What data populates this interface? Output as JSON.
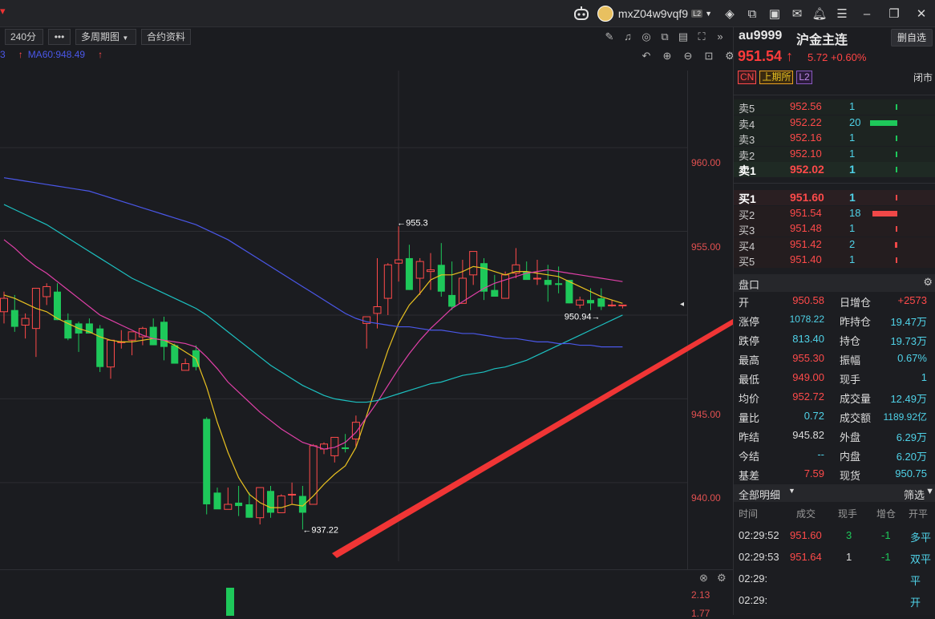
{
  "window": {
    "username": "mxZ04w9vqf9",
    "level_badge": "L2",
    "icons": [
      "robot-icon",
      "layers-icon",
      "export-icon",
      "tv-icon",
      "mail-icon",
      "bell-icon",
      "menu-icon",
      "minimize-icon",
      "restore-icon",
      "close-icon"
    ]
  },
  "toolbar": {
    "period": "240分",
    "more": "•••",
    "multi_period": "多周期图",
    "contract_info": "合约资料"
  },
  "ma_legend": {
    "ma60": "MA60:948.49",
    "ma60_color": "#4a57e8",
    "prefix_fragment": "3"
  },
  "chart": {
    "y_ticks": [
      "960.00",
      "955.00",
      "945.00",
      "940.00"
    ],
    "high_marker": "←955.3",
    "low_marker": "←937.22",
    "last_marker": "950.94→",
    "sub_ticks": [
      "2.13",
      "1.77"
    ]
  },
  "chart_data": {
    "type": "candlestick",
    "ylim": [
      935.3,
      964.6
    ],
    "candles": [
      [
        950.2,
        951.4,
        949.5,
        951.0
      ],
      [
        950.3,
        951.2,
        949.0,
        949.3
      ],
      [
        949.4,
        950.1,
        948.6,
        949.8
      ],
      [
        949.2,
        951.6,
        947.5,
        951.6
      ],
      [
        951.1,
        951.9,
        950.6,
        951.7
      ],
      [
        951.4,
        951.9,
        949.7,
        949.7
      ],
      [
        949.7,
        950.1,
        948.5,
        948.6
      ],
      [
        949.5,
        949.6,
        947.8,
        948.9
      ],
      [
        949.5,
        949.8,
        948.9,
        948.9
      ],
      [
        949.2,
        949.4,
        946.6,
        946.9
      ],
      [
        946.9,
        948.5,
        946.2,
        948.5
      ],
      [
        948.4,
        949.1,
        948.0,
        948.4
      ],
      [
        948.5,
        949.0,
        947.6,
        949.0
      ],
      [
        948.7,
        949.3,
        948.2,
        949.2
      ],
      [
        949.3,
        949.8,
        948.2,
        948.2
      ],
      [
        949.6,
        949.9,
        947.3,
        948.1
      ],
      [
        948.2,
        948.3,
        947.3,
        947.1
      ],
      [
        946.7,
        947.4,
        946.9,
        947.1
      ],
      [
        947.9,
        948.2,
        946.7,
        946.9
      ],
      [
        943.8,
        943.9,
        938.1,
        938.7
      ],
      [
        939.4,
        939.7,
        938.7,
        938.4
      ],
      [
        938.4,
        939.7,
        938.7,
        938.7
      ],
      [
        938.8,
        939.8,
        938.0,
        938.6
      ],
      [
        938.7,
        939.4,
        937.9,
        937.9
      ],
      [
        937.9,
        939.7,
        937.5,
        939.7
      ],
      [
        939.5,
        939.8,
        937.9,
        938.2
      ],
      [
        938.2,
        939.3,
        938.4,
        939.2
      ],
      [
        939.3,
        940.0,
        938.7,
        939.3
      ],
      [
        939.2,
        939.8,
        937.2,
        938.2
      ],
      [
        938.7,
        942.3,
        939.3,
        942.2
      ],
      [
        942.0,
        942.4,
        941.7,
        942.3
      ],
      [
        941.6,
        942.7,
        941.2,
        942.7
      ],
      [
        942.1,
        942.9,
        941.8,
        942.0
      ],
      [
        942.6,
        944.0,
        942.1,
        943.6
      ],
      [
        949.5,
        949.5,
        948.0,
        949.9
      ],
      [
        950.1,
        953.4,
        949.2,
        950.5
      ],
      [
        951.0,
        953.1,
        950.0,
        953.0
      ],
      [
        953.1,
        955.3,
        952.0,
        953.3
      ],
      [
        953.4,
        954.2,
        951.5,
        951.5
      ],
      [
        952.2,
        953.4,
        951.2,
        953.2
      ],
      [
        952.6,
        953.7,
        951.5,
        952.7
      ],
      [
        953.0,
        954.3,
        951.1,
        951.4
      ],
      [
        951.2,
        953.2,
        950.3,
        950.5
      ],
      [
        950.7,
        953.3,
        950.8,
        952.2
      ],
      [
        952.4,
        953.5,
        951.8,
        953.8
      ],
      [
        953.1,
        953.4,
        950.9,
        951.4
      ],
      [
        951.5,
        952.4,
        951.2,
        951.1
      ],
      [
        951.0,
        952.6,
        951.6,
        952.4
      ],
      [
        952.5,
        954.0,
        952.2,
        953.0
      ],
      [
        952.6,
        953.2,
        952.3,
        952.1
      ],
      [
        952.2,
        953.3,
        951.8,
        952.2
      ],
      [
        952.1,
        953.0,
        950.8,
        951.8
      ],
      [
        951.9,
        952.9,
        951.3,
        951.8
      ],
      [
        952.1,
        951.6,
        950.7,
        950.7
      ],
      [
        950.6,
        951.1,
        950.4,
        950.9
      ],
      [
        950.9,
        951.6,
        950.3,
        950.7
      ],
      [
        951.0,
        951.6,
        950.3,
        950.5
      ],
      [
        950.6,
        950.9,
        950.5,
        950.6
      ],
      [
        950.6,
        950.6,
        950.4,
        950.6
      ]
    ],
    "series": [
      {
        "color": "#e8c020",
        "values": [
          951.2,
          951.0,
          950.7,
          950.4,
          950.2,
          949.8,
          949.5,
          949.2,
          949.0,
          948.7,
          948.5,
          948.4,
          948.4,
          948.5,
          948.6,
          948.5,
          948.2,
          947.8,
          947.4,
          945.7,
          943.6,
          941.8,
          940.3,
          939.3,
          938.8,
          938.5,
          938.5,
          938.7,
          938.6,
          939.2,
          939.9,
          940.5,
          941.0,
          942.1,
          944.0,
          946.0,
          947.9,
          949.5,
          950.6,
          951.3,
          952.1,
          952.4,
          952.4,
          952.6,
          952.9,
          952.8,
          952.6,
          952.4,
          952.6,
          952.6,
          952.5,
          952.4,
          952.3,
          952.0,
          951.7,
          951.4,
          951.1,
          950.9,
          950.7
        ]
      },
      {
        "color": "#e040a8",
        "values": [
          954.5,
          954.0,
          953.4,
          952.9,
          952.5,
          952.0,
          951.5,
          951.0,
          950.5,
          950.0,
          949.7,
          949.4,
          949.1,
          948.8,
          948.6,
          948.5,
          948.4,
          948.3,
          948.1,
          947.5,
          946.8,
          946.0,
          945.4,
          944.8,
          944.2,
          943.7,
          943.2,
          942.8,
          942.4,
          942.2,
          942.0,
          942.1,
          942.4,
          943.0,
          943.9,
          944.8,
          945.8,
          946.8,
          947.7,
          948.5,
          949.2,
          949.8,
          950.4,
          950.8,
          951.2,
          951.6,
          951.9,
          952.1,
          952.3,
          952.5,
          952.6,
          952.7,
          952.6,
          952.5,
          952.4,
          952.3,
          952.2,
          952.1,
          952.0
        ]
      },
      {
        "color": "#1cc0c0",
        "values": [
          956.6,
          956.3,
          956.0,
          955.7,
          955.4,
          955.0,
          954.6,
          954.2,
          953.8,
          953.4,
          953.0,
          952.6,
          952.2,
          951.9,
          951.6,
          951.3,
          951.0,
          950.7,
          950.4,
          950.0,
          949.5,
          949.0,
          948.5,
          948.0,
          947.5,
          947.0,
          946.6,
          946.2,
          945.8,
          945.5,
          945.2,
          945.0,
          944.9,
          944.8,
          944.8,
          944.9,
          945.1,
          945.3,
          945.5,
          945.7,
          945.9,
          946.0,
          946.2,
          946.4,
          946.5,
          946.6,
          946.8,
          946.9,
          947.1,
          947.3,
          947.6,
          947.9,
          948.2,
          948.5,
          948.8,
          949.1,
          949.4,
          949.7,
          950.0
        ]
      },
      {
        "color": "#4a57e8",
        "values": [
          958.2,
          958.1,
          958.0,
          957.9,
          957.8,
          957.7,
          957.6,
          957.5,
          957.4,
          957.2,
          957.0,
          956.8,
          956.6,
          956.4,
          956.2,
          956.0,
          955.8,
          955.6,
          955.4,
          955.1,
          954.8,
          954.5,
          954.1,
          953.7,
          953.3,
          952.9,
          952.5,
          952.1,
          951.7,
          951.3,
          950.9,
          950.5,
          950.1,
          949.8,
          949.6,
          949.5,
          949.4,
          949.3,
          949.3,
          949.2,
          949.1,
          949.1,
          949.0,
          948.9,
          948.9,
          948.8,
          948.7,
          948.6,
          948.6,
          948.5,
          948.4,
          948.4,
          948.3,
          948.3,
          948.2,
          948.2,
          948.1,
          948.1,
          948.1
        ]
      }
    ],
    "volume_bar": 1
  },
  "quote": {
    "code": "au9999",
    "name": "沪金主连",
    "remove_btn": "删自选",
    "price": "951.54",
    "arrow": "↑",
    "change": "5.72",
    "change_pct": "+0.60%",
    "tags": [
      "CN",
      "上期所",
      "L2"
    ],
    "status": "闭市"
  },
  "orderbook": {
    "asks": [
      {
        "label": "卖5",
        "price": "952.56",
        "vol": "1",
        "bar": 0.05
      },
      {
        "label": "卖4",
        "price": "952.22",
        "vol": "20",
        "bar": 1.0
      },
      {
        "label": "卖3",
        "price": "952.16",
        "vol": "1",
        "bar": 0.05
      },
      {
        "label": "卖2",
        "price": "952.10",
        "vol": "1",
        "bar": 0.05
      },
      {
        "label": "卖1",
        "price": "952.02",
        "vol": "1",
        "bar": 0.05
      }
    ],
    "bids": [
      {
        "label": "买1",
        "price": "951.60",
        "vol": "1",
        "bar": 0.05
      },
      {
        "label": "买2",
        "price": "951.54",
        "vol": "18",
        "bar": 0.9
      },
      {
        "label": "买3",
        "price": "951.48",
        "vol": "1",
        "bar": 0.05
      },
      {
        "label": "买4",
        "price": "951.42",
        "vol": "2",
        "bar": 0.1
      },
      {
        "label": "买5",
        "price": "951.40",
        "vol": "1",
        "bar": 0.05
      }
    ]
  },
  "stats": {
    "header": "盘口",
    "rows": [
      {
        "l1": "开",
        "v1": "950.58",
        "c1": "#ff4a4a",
        "l2": "日增仓",
        "v2": "+2573",
        "c2": "#ff4a4a"
      },
      {
        "l1": "涨停",
        "v1": "1078.22",
        "c1": "#4fd2e8",
        "l2": "昨持仓",
        "v2": "19.47万",
        "c2": "#4fd2e8"
      },
      {
        "l1": "跌停",
        "v1": "813.40",
        "c1": "#4fd2e8",
        "l2": "持仓",
        "v2": "19.73万",
        "c2": "#4fd2e8"
      },
      {
        "l1": "最高",
        "v1": "955.30",
        "c1": "#ff4a4a",
        "l2": "振幅",
        "v2": "0.67%",
        "c2": "#4fd2e8"
      },
      {
        "l1": "最低",
        "v1": "949.00",
        "c1": "#ff4a4a",
        "l2": "现手",
        "v2": "1",
        "c2": "#4fd2e8"
      },
      {
        "l1": "均价",
        "v1": "952.72",
        "c1": "#ff4a4a",
        "l2": "成交量",
        "v2": "12.49万",
        "c2": "#4fd2e8"
      },
      {
        "l1": "量比",
        "v1": "0.72",
        "c1": "#4fd2e8",
        "l2": "成交额",
        "v2": "1189.92亿",
        "c2": "#4fd2e8"
      },
      {
        "l1": "昨结",
        "v1": "945.82",
        "c1": "#dddddd",
        "l2": "外盘",
        "v2": "6.29万",
        "c2": "#4fd2e8"
      },
      {
        "l1": "今结",
        "v1": "--",
        "c1": "#4fd2e8",
        "l2": "内盘",
        "v2": "6.20万",
        "c2": "#4fd2e8"
      },
      {
        "l1": "基差",
        "v1": "7.59",
        "c1": "#ff4a4a",
        "l2": "现货",
        "v2": "950.75",
        "c2": "#4fd2e8"
      }
    ]
  },
  "detail": {
    "title": "全部明细",
    "filter": "筛选",
    "columns": [
      "时间",
      "成交",
      "现手",
      "增仓",
      "开平"
    ],
    "rows": [
      {
        "time": "02:29:52",
        "price": "951.60",
        "qty": "3",
        "qty_color": "#1ec85a",
        "oi": "-1",
        "type": "多平",
        "type_color": "#4fd2e8"
      },
      {
        "time": "02:29:53",
        "price": "951.64",
        "qty": "1",
        "qty_color": "#dddddd",
        "oi": "-1",
        "type": "双平",
        "type_color": "#4fd2e8"
      },
      {
        "time": "02:29:",
        "price": "",
        "qty": "",
        "qty_color": "#dddddd",
        "oi": "",
        "type": "平",
        "type_color": "#4fd2e8"
      },
      {
        "time": "02:29:",
        "price": "",
        "qty": "",
        "qty_color": "#dddddd",
        "oi": "",
        "type": "开",
        "type_color": "#4fd2e8"
      }
    ]
  }
}
